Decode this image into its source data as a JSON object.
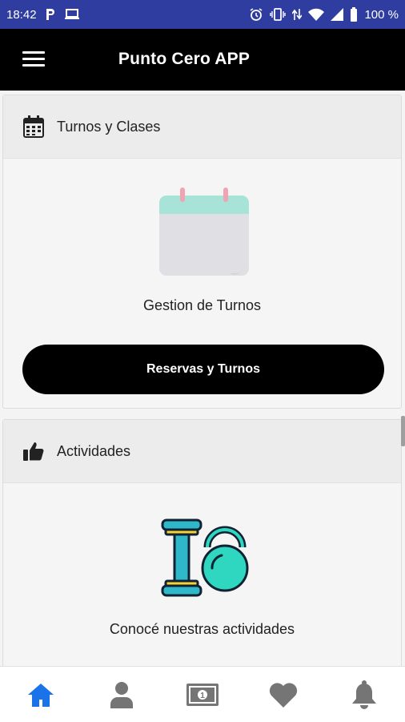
{
  "status_bar": {
    "time": "18:42",
    "battery": "100 %",
    "icons": [
      "p-icon",
      "laptop-icon",
      "alarm-icon",
      "vibrate-icon",
      "data-arrows-icon",
      "wifi-icon",
      "signal-icon",
      "battery-icon"
    ]
  },
  "app_bar": {
    "title": "Punto Cero APP",
    "menu_icon": "hamburger-menu-icon"
  },
  "cards": [
    {
      "header": "Turnos y Clases",
      "header_icon": "calendar-icon",
      "illustration": "calendar-illustration",
      "caption": "Gestion de Turnos",
      "button_label": "Reservas y Turnos"
    },
    {
      "header": "Actividades",
      "header_icon": "thumbs-up-icon",
      "illustration": "dumbbell-kettlebell-illustration",
      "caption": "Conocé nuestras actividades"
    }
  ],
  "bottom_nav": {
    "items": [
      "home-icon",
      "user-icon",
      "money-icon",
      "heart-icon",
      "bell-icon"
    ],
    "active_color": "#1a73e8",
    "inactive_color": "#757575"
  }
}
